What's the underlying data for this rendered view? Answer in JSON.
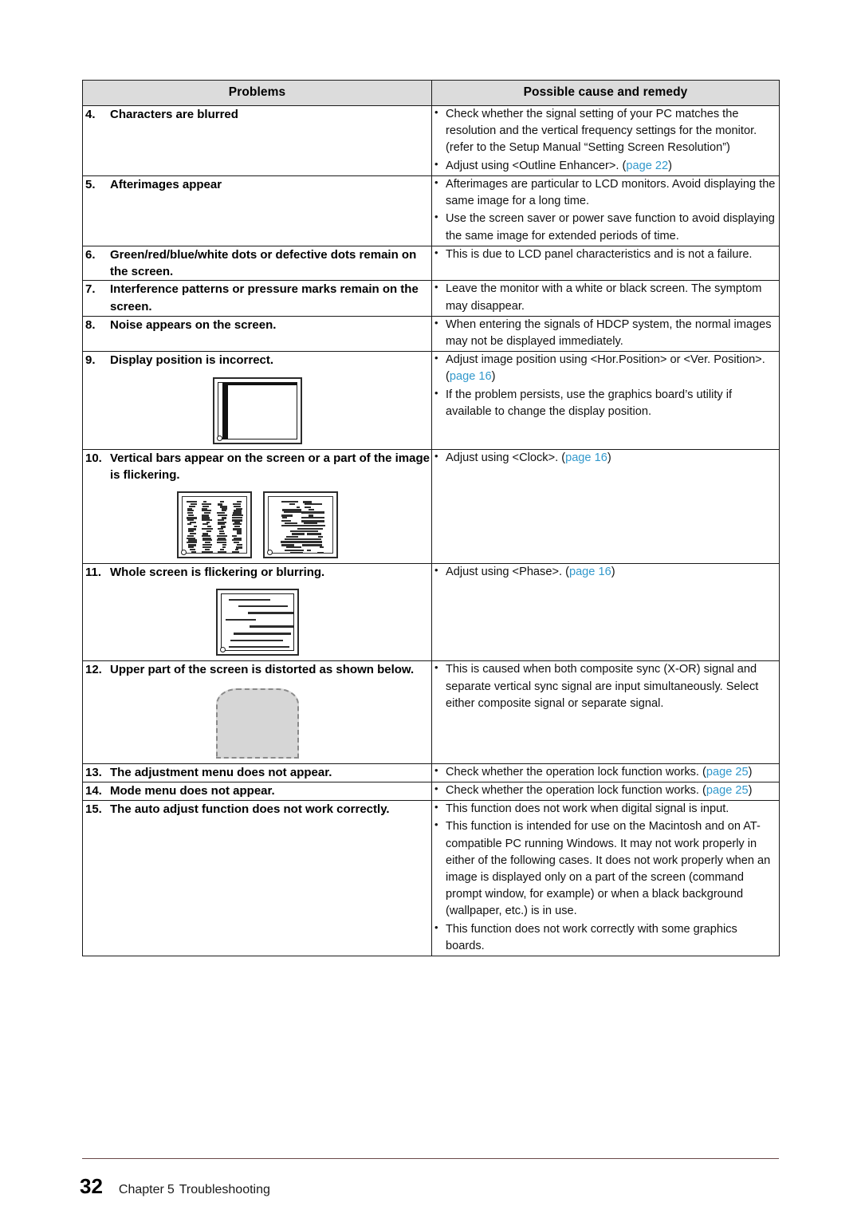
{
  "document": {
    "table": {
      "headers": [
        "Problems",
        "Possible cause and remedy"
      ],
      "rows": [
        {
          "num": "4.",
          "problem": "Characters are blurred",
          "figure": "none",
          "remedies": [
            {
              "text": "Check whether the signal setting of your PC matches the resolution and the vertical frequency settings for the monitor. (refer to the Setup Manual “Setting Screen Resolution”)",
              "link": "",
              "tail": ""
            },
            {
              "text": "Adjust using <Outline Enhancer>. (",
              "link": "page 22",
              "tail": ")"
            }
          ]
        },
        {
          "num": "5.",
          "problem": "Afterimages appear",
          "figure": "none",
          "remedies": [
            {
              "text": "Afterimages are particular to LCD monitors. Avoid displaying the same image for a long time.",
              "link": "",
              "tail": ""
            },
            {
              "text": "Use the screen saver or power save function to avoid displaying the same image for extended periods of time.",
              "link": "",
              "tail": ""
            }
          ]
        },
        {
          "num": "6.",
          "problem": "Green/red/blue/white dots or defective dots remain on the screen.",
          "figure": "none",
          "remedies": [
            {
              "text": "This is due to LCD panel characteristics and is not a failure.",
              "link": "",
              "tail": ""
            }
          ]
        },
        {
          "num": "7.",
          "problem": "Interference patterns or pressure marks remain on the screen.",
          "figure": "none",
          "remedies": [
            {
              "text": "Leave the monitor with a white or black screen. The symptom may disappear.",
              "link": "",
              "tail": ""
            }
          ]
        },
        {
          "num": "8.",
          "problem": "Noise appears on the screen.",
          "figure": "none",
          "remedies": [
            {
              "text": "When entering the signals of HDCP system, the normal images may not be displayed immediately.",
              "link": "",
              "tail": ""
            }
          ]
        },
        {
          "num": "9.",
          "problem": "Display position is incorrect.",
          "figure": "display-position-diagram",
          "remedies": [
            {
              "text": "Adjust image position using <Hor.Position> or <Ver. Position>. (",
              "link": "page 16",
              "tail": ")"
            },
            {
              "text": "If the problem persists, use the graphics board’s utility if available to change the display position.",
              "link": "",
              "tail": ""
            }
          ]
        },
        {
          "num": "10.",
          "problem": "Vertical bars appear on the screen or a part of the image is flickering.",
          "figure": "vertical-bars-diagram",
          "remedies": [
            {
              "text": "Adjust using <Clock>. (",
              "link": "page 16",
              "tail": ")"
            }
          ]
        },
        {
          "num": "11.",
          "problem": "Whole screen is flickering or blurring.",
          "figure": "flickering-screen-diagram",
          "remedies": [
            {
              "text": "Adjust using <Phase>. (",
              "link": "page 16",
              "tail": ")"
            }
          ]
        },
        {
          "num": "12.",
          "problem": "Upper part of the screen is distorted as shown below.",
          "figure": "distorted-screen-diagram",
          "remedies": [
            {
              "text": "This is caused when both composite sync (X-OR) signal and separate vertical sync signal are input simultaneously. Select either composite signal or separate signal.",
              "link": "",
              "tail": ""
            }
          ]
        },
        {
          "num": "13.",
          "problem": "The adjustment menu does not appear.",
          "figure": "none",
          "remedies": [
            {
              "text": "Check whether the operation lock function works. (",
              "link": "page 25",
              "tail": ")"
            }
          ]
        },
        {
          "num": "14.",
          "problem": "Mode menu does not appear.",
          "figure": "none",
          "remedies": [
            {
              "text": "Check whether the operation lock function works. (",
              "link": "page 25",
              "tail": ")"
            }
          ]
        },
        {
          "num": "15.",
          "problem": "The auto adjust function does not work correctly.",
          "figure": "none",
          "remedies": [
            {
              "text": "This function does not work when digital signal is input.",
              "link": "",
              "tail": ""
            },
            {
              "text": "This function is intended for use on the Macintosh and on AT-compatible PC running Windows. It may not work properly in either of the following cases. It does not work properly when an image is displayed only on a part of the screen (command prompt window, for example) or when a black background (wallpaper, etc.) is in use.",
              "link": "",
              "tail": ""
            },
            {
              "text": "This function does not work correctly with some graphics boards.",
              "link": "",
              "tail": ""
            }
          ]
        }
      ]
    },
    "footer": {
      "page_number": "32",
      "chapter_word": "Chapter",
      "chapter_number": "5",
      "chapter_title": "Troubleshooting"
    },
    "colors": {
      "link": "#3399cc",
      "header_background": "#dcdcdc",
      "border": "#1a1a1a",
      "footer_rule": "#6b4a4a",
      "figure_fill": "#d6d6d6"
    }
  }
}
